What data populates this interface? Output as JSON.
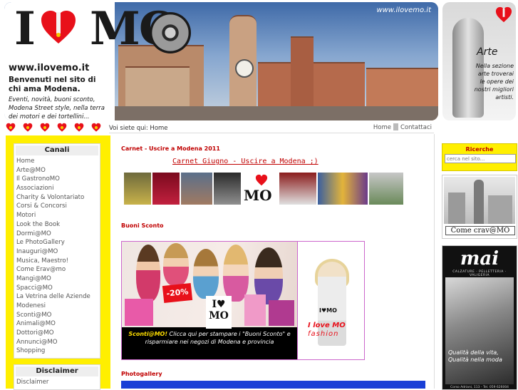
{
  "header": {
    "logo_i": "I",
    "logo_mo": "MO",
    "site_url": "www.ilovemo.it",
    "welcome": "Benvenuti nel sito di chi ama Modena.",
    "welcome_sub": "Eventi, novità, buoni sconto, Modena Street style, nella terra dei motori e dei tortellini...",
    "banner_url": "www.ilovemo.it"
  },
  "arte_ad": {
    "title": "Arte",
    "text": "Nella sezione arte troverai le opere dei nostri migliori artisti."
  },
  "breadcrumb": {
    "prefix": "Voi siete qui:",
    "current": "Home"
  },
  "topnav": {
    "items": [
      "Home",
      "Contattaci"
    ]
  },
  "sidebar": {
    "canali_title": "Canali",
    "items": [
      "Home",
      "Arte@MO",
      "Il GastronoMO",
      "Associazioni",
      "Charity & Volontariato",
      "Corsi & Concorsi",
      "Motori",
      "Look the Book",
      "Dormi@MO",
      "Le PhotoGallery",
      "Inauguri@MO",
      "Musica, Maestro!",
      "Come Erav@mo",
      "Mangi@MO",
      "Spacci@MO",
      "La Vetrina delle Aziende",
      "Modenesi",
      "Sconti@MO",
      "Animali@MO",
      "Dottori@MO",
      "Annunci@MO",
      "Shopping"
    ],
    "disclaimer_title": "Disclaimer",
    "disclaimer_item": "Disclaimer"
  },
  "main": {
    "carnet_title": "Carnet - Uscire a Modena 2011",
    "carnet_link": "Carnet Giugno - Uscire a Modena ;)",
    "buoni_title": "Buoni Sconto",
    "promo_badge": "-20%",
    "promo_logo": "I♥ MO",
    "promo_text_bold": "Sconti@MO!",
    "promo_text": "Clicca qui per stampare i \"Buoni Sconto\" e risparmiare nei negozi di Modena e provincia",
    "fashion_logo": "I♥MO",
    "fashion_line1": "I love MO",
    "fashion_line2": "fashion",
    "photogallery_title": "Photogallery"
  },
  "right": {
    "ricerche_title": "Ricerche",
    "search_placeholder": "cerca nel sito...",
    "crav_caption": "Come crav@MO",
    "mai_title": "mai",
    "mai_sub": "CALZATURE · PELLETTERIA · VALIGERIA",
    "mai_tag": "Qualità della vita, Qualità nella moda",
    "mai_foot": "Corso Adriani, 113 - Tel. 059 626004"
  },
  "colors": {
    "sidebar_yellow": "#ffef00",
    "title_red": "#c00000",
    "promo_border": "#cc66cc",
    "photo_bar": "#1a3fd6"
  }
}
